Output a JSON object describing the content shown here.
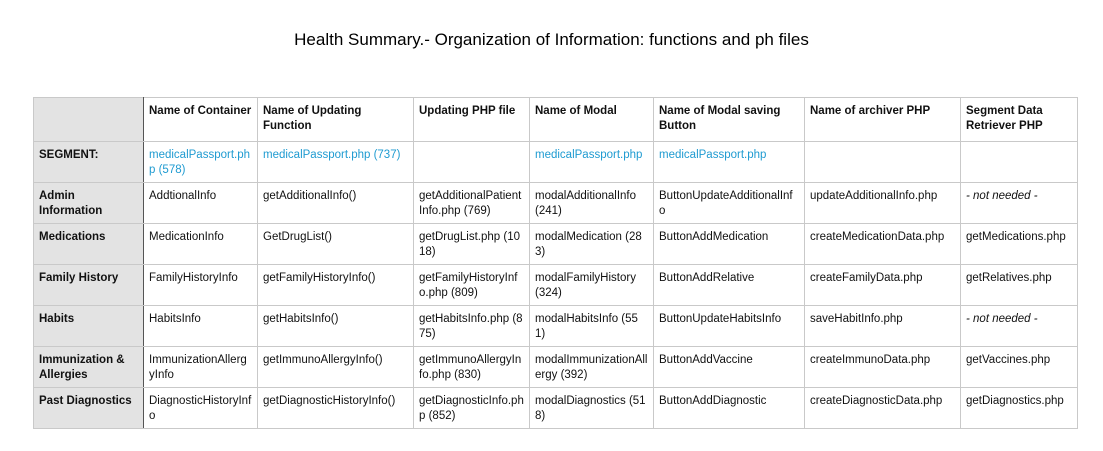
{
  "title": "Health Summary.- Organization of Information: functions and ph files",
  "link_color": "#1f9bd1",
  "table": {
    "headers": [
      "",
      "Name of Container",
      "Name of Updating Function",
      "Updating PHP file",
      "Name of Modal",
      "Name of Modal saving Button",
      "Name of archiver PHP",
      "Segment Data Retriever PHP"
    ],
    "rows": [
      {
        "segment": "SEGMENT:",
        "cells": [
          "medicalPassport.php (578)",
          "medicalPassport.php (737)",
          "",
          "medicalPassport.php",
          "medicalPassport.php",
          "",
          ""
        ]
      },
      {
        "segment": "Admin Information",
        "cells": [
          "AddtionalInfo",
          "getAdditionalInfo()",
          "getAdditionalPatientInfo.php (769)",
          "modalAdditionalInfo (241)",
          "ButtonUpdateAdditionalInfo",
          "updateAdditionalInfo.php",
          "- not needed -"
        ]
      },
      {
        "segment": "Medications",
        "cells": [
          "MedicationInfo",
          "GetDrugList()",
          "getDrugList.php (1018)",
          "modalMedication (283)",
          "ButtonAddMedication",
          "createMedicationData.php",
          "getMedications.php"
        ]
      },
      {
        "segment": "Family History",
        "cells": [
          "FamilyHistoryInfo",
          "getFamilyHistoryInfo()",
          "getFamilyHistoryInfo.php (809)",
          "modalFamilyHistory (324)",
          "ButtonAddRelative",
          "createFamilyData.php",
          "getRelatives.php"
        ]
      },
      {
        "segment": "Habits",
        "cells": [
          "HabitsInfo",
          "getHabitsInfo()",
          "getHabitsInfo.php (875)",
          "modalHabitsInfo (551)",
          "ButtonUpdateHabitsInfo",
          "saveHabitInfo.php",
          "- not needed -"
        ]
      },
      {
        "segment": "Immunization & Allergies",
        "cells": [
          "ImmunizationAllergyInfo",
          "getImmunoAllergyInfo()",
          "getImmunoAllergyInfo.php (830)",
          "modalImmunizationAllergy (392)",
          "ButtonAddVaccine",
          "createImmunoData.php",
          "getVaccines.php"
        ]
      },
      {
        "segment": "Past Diagnostics",
        "cells": [
          "DiagnosticHistoryInfo",
          "getDiagnosticHistoryInfo()",
          "getDiagnosticInfo.php (852)",
          "modalDiagnostics (518)",
          "ButtonAddDiagnostic",
          "createDiagnosticData.php",
          "getDiagnostics.php"
        ]
      }
    ]
  }
}
